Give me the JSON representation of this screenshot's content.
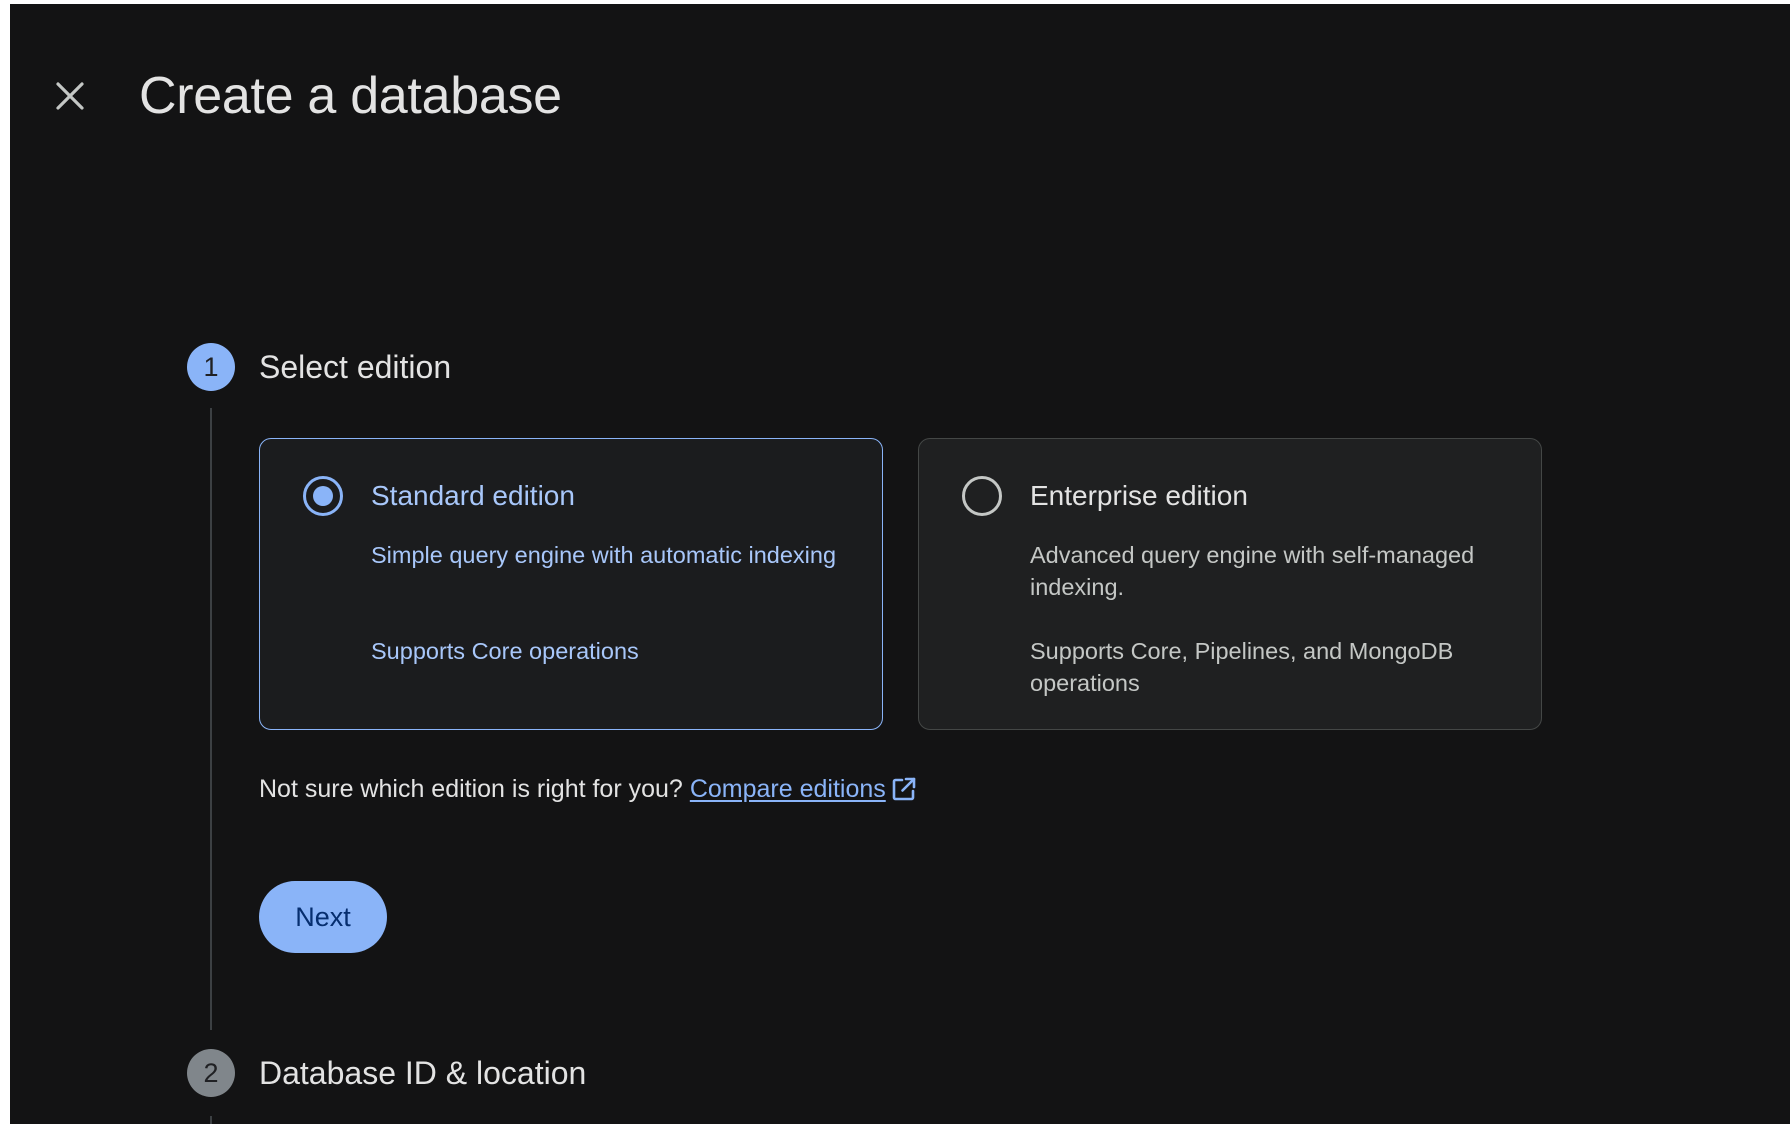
{
  "header": {
    "close_icon": "close-icon",
    "title": "Create a database"
  },
  "steps": [
    {
      "number": "1",
      "title": "Select edition",
      "state": "active"
    },
    {
      "number": "2",
      "title": "Database ID & location",
      "state": "inactive"
    }
  ],
  "editions": {
    "standard": {
      "title": "Standard edition",
      "description": "Simple query engine with automatic indexing",
      "operations": "Supports Core operations",
      "selected": true
    },
    "enterprise": {
      "title": "Enterprise edition",
      "description": "Advanced query engine with self-managed indexing.",
      "operations": "Supports Core, Pipelines, and MongoDB operations",
      "selected": false
    }
  },
  "help": {
    "question": "Not sure which edition is right for you?",
    "link_label": "Compare editions",
    "link_icon": "open-in-new-icon"
  },
  "actions": {
    "next_label": "Next"
  },
  "colors": {
    "background": "#131314",
    "accent": "#8ab4f8",
    "text_primary": "#e3e3e3",
    "text_secondary": "#c4c7c5",
    "selected_text": "#a8c7fa",
    "inactive_step": "#80868b"
  }
}
